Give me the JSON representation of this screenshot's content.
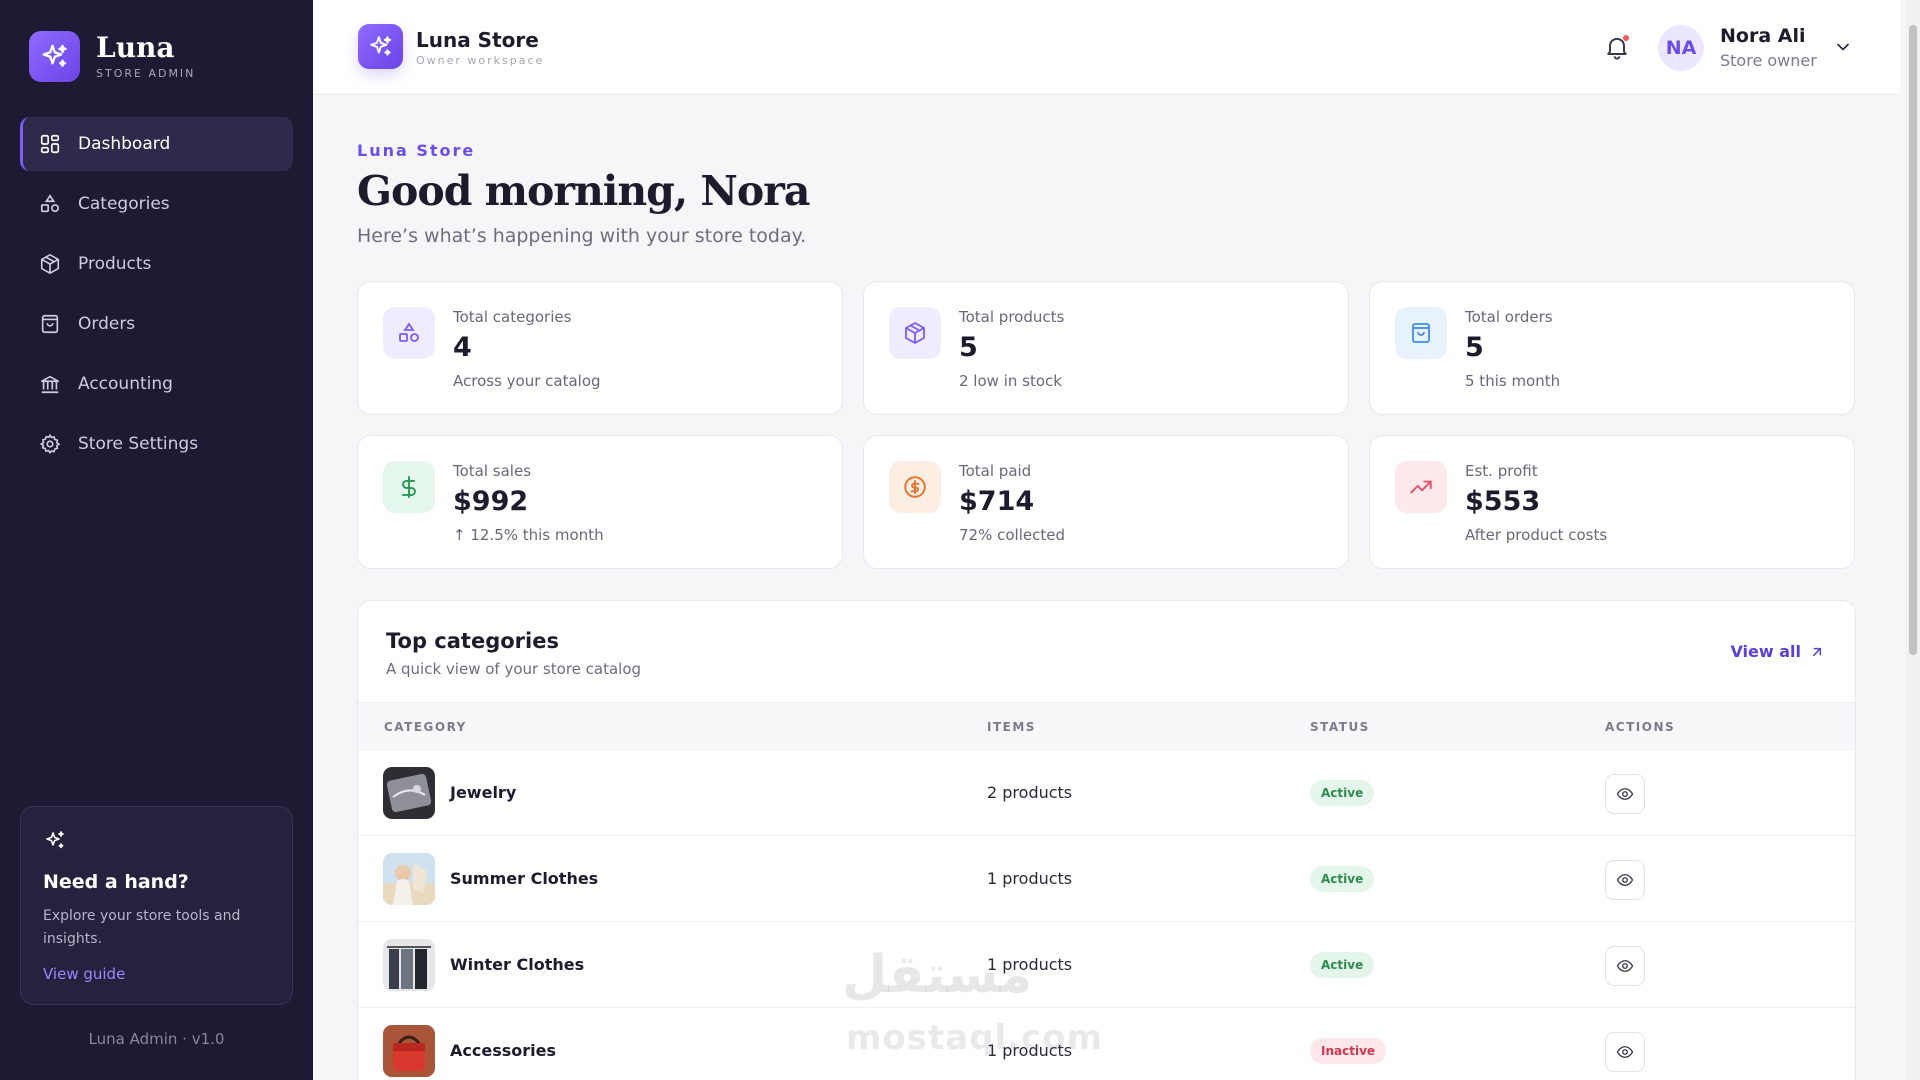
{
  "sidebar": {
    "brand_name": "Luna",
    "brand_sub": "STORE ADMIN",
    "items": [
      {
        "label": "Dashboard",
        "icon": "dashboard-grid-icon"
      },
      {
        "label": "Categories",
        "icon": "shapes-icon"
      },
      {
        "label": "Products",
        "icon": "box-icon"
      },
      {
        "label": "Orders",
        "icon": "shopping-bag-icon"
      },
      {
        "label": "Accounting",
        "icon": "bank-icon"
      },
      {
        "label": "Store Settings",
        "icon": "gear-icon"
      }
    ],
    "active_item": "Dashboard",
    "help": {
      "title": "Need a hand?",
      "text": "Explore your store tools and insights.",
      "link": "View guide"
    },
    "version": "Luna Admin · v1.0"
  },
  "topbar": {
    "store_name": "Luna Store",
    "store_sub": "Owner workspace",
    "user_initials": "NA",
    "user_name": "Nora Ali",
    "user_role": "Store owner"
  },
  "main": {
    "eyebrow": "Luna Store",
    "greeting": "Good morning, Nora",
    "subtitle": "Here’s what’s happening with your store today."
  },
  "stats": [
    {
      "label": "Total categories",
      "value": "4",
      "note": "Across your catalog",
      "icon": "shapes-icon",
      "color": "#7c5cf5",
      "bg": "#f0ecff"
    },
    {
      "label": "Total products",
      "value": "5",
      "note": "2 low in stock",
      "icon": "box-icon",
      "color": "#7c5cf5",
      "bg": "#f0ecff"
    },
    {
      "label": "Total orders",
      "value": "5",
      "note": "5 this month",
      "icon": "shopping-bag-icon",
      "color": "#3a8ee6",
      "bg": "#e8f2fd"
    },
    {
      "label": "Total sales",
      "value": "$992",
      "note": "↑ 12.5% this month",
      "icon": "dollar-icon",
      "color": "#2f9a5a",
      "bg": "#e5f6ec"
    },
    {
      "label": "Total paid",
      "value": "$714",
      "note": "72% collected",
      "icon": "coin-icon",
      "color": "#e8742f",
      "bg": "#fdeee3"
    },
    {
      "label": "Est. profit",
      "value": "$553",
      "note": "After product costs",
      "icon": "trend-up-icon",
      "color": "#e0566c",
      "bg": "#fde9ec"
    }
  ],
  "top_categories": {
    "title": "Top categories",
    "subtitle": "A quick view of your store catalog",
    "view_all": "View all",
    "columns": [
      "CATEGORY",
      "ITEMS",
      "STATUS",
      "ACTIONS"
    ],
    "rows": [
      {
        "name": "Jewelry",
        "items": "2 products",
        "status": "Active",
        "status_kind": "active"
      },
      {
        "name": "Summer Clothes",
        "items": "1 products",
        "status": "Active",
        "status_kind": "active"
      },
      {
        "name": "Winter Clothes",
        "items": "1 products",
        "status": "Active",
        "status_kind": "active"
      },
      {
        "name": "Accessories",
        "items": "1 products",
        "status": "Inactive",
        "status_kind": "inactive"
      }
    ]
  },
  "watermark": {
    "arabic": "مستقل",
    "latin": "mostaql.com"
  },
  "colors": {
    "accent": "#7c5cf5",
    "sidebar_bg": "#1e1a33",
    "active_badge": "#2f8a4f",
    "inactive_badge": "#d2394f"
  }
}
